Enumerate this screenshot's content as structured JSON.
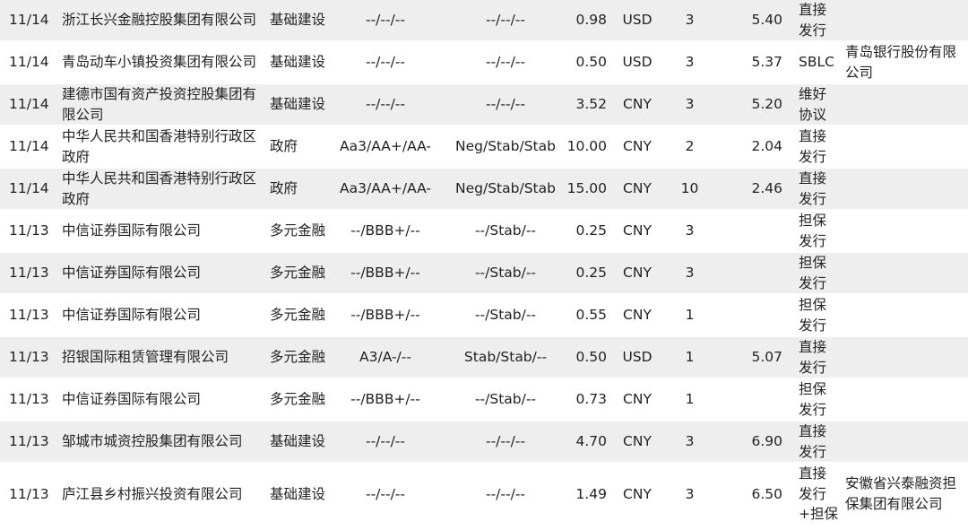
{
  "rows": [
    {
      "date": "11/14",
      "issuer": "浙江长兴金融控股集团有限公司",
      "sector": "基础建设",
      "rating": "--/--/--",
      "outlook": "--/--/--",
      "amount": "0.98",
      "currency": "USD",
      "tenor": "3",
      "coupon": "5.40",
      "structure": "直接发行",
      "guarantor": ""
    },
    {
      "date": "11/14",
      "issuer": "青岛动车小镇投资集团有限公司",
      "sector": "基础建设",
      "rating": "--/--/--",
      "outlook": "--/--/--",
      "amount": "0.50",
      "currency": "USD",
      "tenor": "3",
      "coupon": "5.37",
      "structure": "SBLC",
      "guarantor": "青岛银行股份有限公司"
    },
    {
      "date": "11/14",
      "issuer": "建德市国有资产投资控股集团有限公司",
      "sector": "基础建设",
      "rating": "--/--/--",
      "outlook": "--/--/--",
      "amount": "3.52",
      "currency": "CNY",
      "tenor": "3",
      "coupon": "5.20",
      "structure": "维好协议",
      "guarantor": ""
    },
    {
      "date": "11/14",
      "issuer": "中华人民共和国香港特别行政区政府",
      "sector": "政府",
      "rating": "Aa3/AA+/AA-",
      "outlook": "Neg/Stab/Stab",
      "amount": "10.00",
      "currency": "CNY",
      "tenor": "2",
      "coupon": "2.04",
      "structure": "直接发行",
      "guarantor": ""
    },
    {
      "date": "11/14",
      "issuer": "中华人民共和国香港特别行政区政府",
      "sector": "政府",
      "rating": "Aa3/AA+/AA-",
      "outlook": "Neg/Stab/Stab",
      "amount": "15.00",
      "currency": "CNY",
      "tenor": "10",
      "coupon": "2.46",
      "structure": "直接发行",
      "guarantor": ""
    },
    {
      "date": "11/13",
      "issuer": "中信证券国际有限公司",
      "sector": "多元金融",
      "rating": "--/BBB+/--",
      "outlook": "--/Stab/--",
      "amount": "0.25",
      "currency": "CNY",
      "tenor": "3",
      "coupon": "",
      "structure": "担保发行",
      "guarantor": ""
    },
    {
      "date": "11/13",
      "issuer": "中信证券国际有限公司",
      "sector": "多元金融",
      "rating": "--/BBB+/--",
      "outlook": "--/Stab/--",
      "amount": "0.25",
      "currency": "CNY",
      "tenor": "3",
      "coupon": "",
      "structure": "担保发行",
      "guarantor": ""
    },
    {
      "date": "11/13",
      "issuer": "中信证券国际有限公司",
      "sector": "多元金融",
      "rating": "--/BBB+/--",
      "outlook": "--/Stab/--",
      "amount": "0.55",
      "currency": "CNY",
      "tenor": "1",
      "coupon": "",
      "structure": "担保发行",
      "guarantor": ""
    },
    {
      "date": "11/13",
      "issuer": "招银国际租赁管理有限公司",
      "sector": "多元金融",
      "rating": "A3/A-/--",
      "outlook": "Stab/Stab/--",
      "amount": "0.50",
      "currency": "USD",
      "tenor": "1",
      "coupon": "5.07",
      "structure": "直接发行",
      "guarantor": ""
    },
    {
      "date": "11/13",
      "issuer": "中信证券国际有限公司",
      "sector": "多元金融",
      "rating": "--/BBB+/--",
      "outlook": "--/Stab/--",
      "amount": "0.73",
      "currency": "CNY",
      "tenor": "1",
      "coupon": "",
      "structure": "担保发行",
      "guarantor": ""
    },
    {
      "date": "11/13",
      "issuer": "邹城市城资控股集团有限公司",
      "sector": "基础建设",
      "rating": "--/--/--",
      "outlook": "--/--/--",
      "amount": "4.70",
      "currency": "CNY",
      "tenor": "3",
      "coupon": "6.90",
      "structure": "直接发行",
      "guarantor": ""
    },
    {
      "date": "11/13",
      "issuer": "庐江县乡村振兴投资有限公司",
      "sector": "基础建设",
      "rating": "--/--/--",
      "outlook": "--/--/--",
      "amount": "1.49",
      "currency": "CNY",
      "tenor": "3",
      "coupon": "6.50",
      "structure": "直接发行+担保",
      "guarantor": "安徽省兴泰融资担保集团有限公司"
    }
  ]
}
